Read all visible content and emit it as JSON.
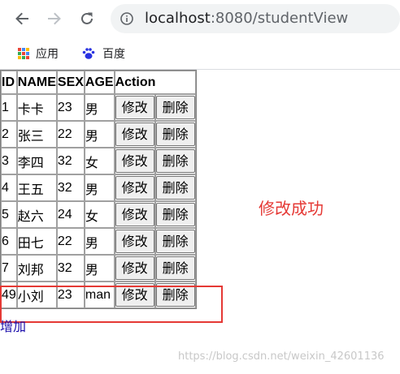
{
  "browser": {
    "url_host": "localhost",
    "url_rest": ":8080/studentView",
    "bookmarks": [
      {
        "label": "应用",
        "icon": "apps-grid-icon"
      },
      {
        "label": "百度",
        "icon": "baidu-paw-icon"
      }
    ]
  },
  "table": {
    "headers": [
      "ID",
      "NAME",
      "SEX",
      "AGE",
      "Action"
    ],
    "rows": [
      {
        "id": "1",
        "name": "卡卡",
        "sex": "23",
        "age": "男"
      },
      {
        "id": "2",
        "name": "张三",
        "sex": "22",
        "age": "男"
      },
      {
        "id": "3",
        "name": "李四",
        "sex": "32",
        "age": "女"
      },
      {
        "id": "4",
        "name": "王五",
        "sex": "32",
        "age": "男"
      },
      {
        "id": "5",
        "name": "赵六",
        "sex": "24",
        "age": "女"
      },
      {
        "id": "6",
        "name": "田七",
        "sex": "22",
        "age": "男"
      },
      {
        "id": "7",
        "name": "刘邦",
        "sex": "32",
        "age": "男"
      },
      {
        "id": "49",
        "name": "小刘",
        "sex": "23",
        "age": "man"
      }
    ],
    "edit_label": "修改",
    "delete_label": "删除"
  },
  "add_link": "增加",
  "annotation": {
    "text": "修改成功",
    "color": "#e53935"
  },
  "watermark": "https://blog.csdn.net/weixin_42601136"
}
